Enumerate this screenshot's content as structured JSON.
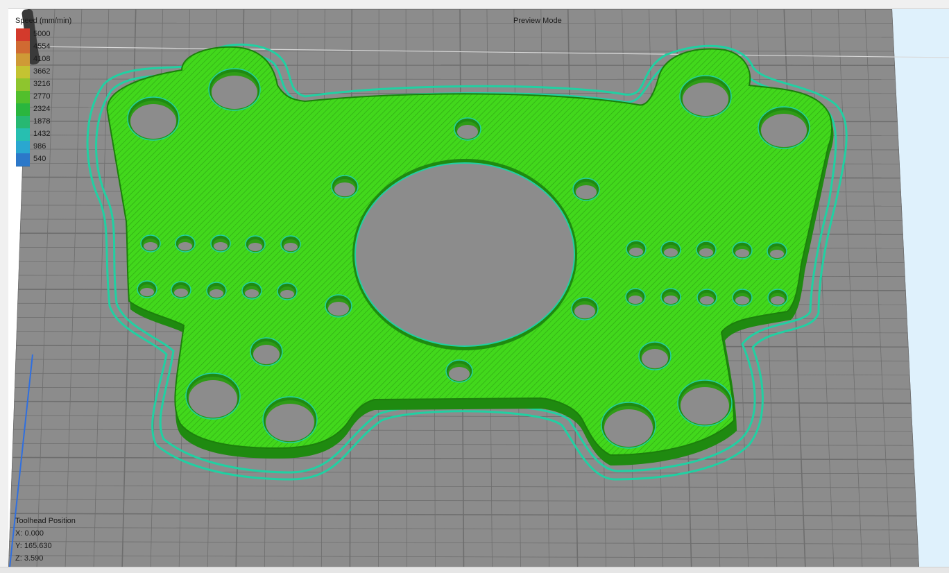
{
  "viewer": {
    "mode_label": "Preview Mode"
  },
  "legend": {
    "title": "Speed (mm/min)",
    "items": [
      {
        "value": "5000",
        "color": "#d33a2c"
      },
      {
        "value": "4554",
        "color": "#d06a32"
      },
      {
        "value": "4108",
        "color": "#cf9a36"
      },
      {
        "value": "3662",
        "color": "#c4c332"
      },
      {
        "value": "3216",
        "color": "#8ec52e"
      },
      {
        "value": "2770",
        "color": "#52bf2c"
      },
      {
        "value": "2324",
        "color": "#2ab63e"
      },
      {
        "value": "1878",
        "color": "#27b872"
      },
      {
        "value": "1432",
        "color": "#27bfb0"
      },
      {
        "value": "986",
        "color": "#2aa7d0"
      },
      {
        "value": "540",
        "color": "#2c78c9"
      }
    ]
  },
  "toolhead": {
    "title": "Toolhead Position",
    "x": "X: 0.000",
    "y": "Y: 165.630",
    "z": "Z: 3.590"
  },
  "colors": {
    "bed": "#8c8c8c",
    "grid_line": "#6e6e6e",
    "print_fill": "#3fd41a",
    "print_edge": "#1f8a10",
    "skirt": "#21d0a2"
  }
}
